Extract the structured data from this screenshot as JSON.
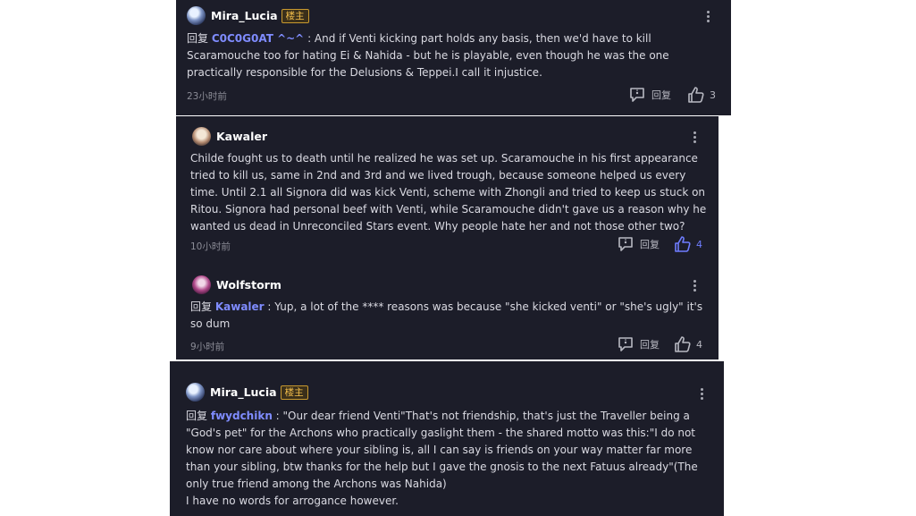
{
  "comments": [
    {
      "username": "Mira_Lucia",
      "badge": "楼主",
      "reply_prefix": "回复",
      "mention": "C0C0G0AT ^~^",
      "separator": " : ",
      "text": "And if Venti kicking part holds any basis, then we'd have to kill Scaramouche too for hating Ei & Nahida - but he is playable, even though he was the one practically responsible for the Delusions & Teppei.I call it injustice.",
      "time": "23小时前",
      "reply_label": "回复",
      "likes": "3"
    },
    {
      "username": "Kawaler",
      "text": "Childe fought us to death until he realized he was set up. Scaramouche in his first appearance tried to kill us, same in 2nd and 3rd and we lived trough, because someone helped us every time. Until 2.1 all Signora did was kick Venti, scheme with Zhongli and tried to keep us stuck on Ritou. Signora had personal beef with Venti, while Scaramouche didn't gave us a reason why he wanted us dead in Unreconciled Stars event. Why people hate her and not those other two?",
      "time": "10小时前",
      "reply_label": "回复",
      "likes": "4",
      "liked": true
    },
    {
      "username": "Wolfstorm",
      "reply_prefix": "回复",
      "mention": "Kawaler",
      "separator": " : ",
      "text": "Yup, a lot of the **** reasons was because \"she kicked venti\" or \"she's ugly\" it's so dum",
      "time": "9小时前",
      "reply_label": "回复",
      "likes": "4"
    },
    {
      "username": "Mira_Lucia",
      "badge": "楼主",
      "reply_prefix": "回复",
      "mention": "fwydchikn",
      "separator": " : ",
      "text": "\"Our dear friend Venti\"That's not friendship, that's just the Traveller being a \"God's pet\" for the Archons who practically gaslight them - the shared motto was this:\"I do not know nor care about where your sibling is, all I can say is friends on your way matter far more than your sibling, btw thanks for the help but I gave the gnosis to the next Fatuus already\"(The only true friend among the Archons was Nahida)",
      "text2": "I have no words for arrogance however."
    }
  ],
  "colors": {
    "panel_bg": "#1c1d29",
    "mention": "#7f8cff",
    "badge": "#f6c04c",
    "liked": "#6f7dff"
  },
  "icons": [
    "avatar",
    "more-dots-icon",
    "comment-reply-icon",
    "thumbs-up-icon"
  ]
}
